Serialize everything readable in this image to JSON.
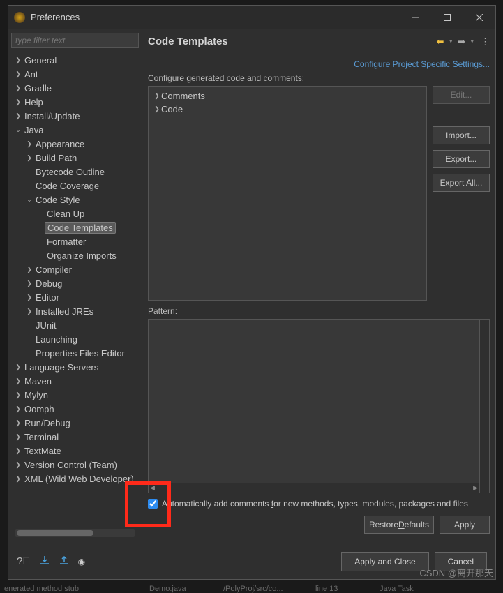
{
  "window": {
    "title": "Preferences"
  },
  "sidebar": {
    "filter_placeholder": "type filter text",
    "items": {
      "general": "General",
      "ant": "Ant",
      "gradle": "Gradle",
      "help": "Help",
      "install_update": "Install/Update",
      "java": "Java",
      "appearance": "Appearance",
      "build_path": "Build Path",
      "bytecode_outline": "Bytecode Outline",
      "code_coverage": "Code Coverage",
      "code_style": "Code Style",
      "clean_up": "Clean Up",
      "code_templates": "Code Templates",
      "formatter": "Formatter",
      "organize_imports": "Organize Imports",
      "compiler": "Compiler",
      "debug": "Debug",
      "editor": "Editor",
      "installed_jres": "Installed JREs",
      "junit": "JUnit",
      "launching": "Launching",
      "properties_files_editor": "Properties Files Editor",
      "language_servers": "Language Servers",
      "maven": "Maven",
      "mylyn": "Mylyn",
      "oomph": "Oomph",
      "run_debug": "Run/Debug",
      "terminal": "Terminal",
      "textmate": "TextMate",
      "version_control": "Version Control (Team)",
      "xml": "XML (Wild Web Developer)"
    }
  },
  "main": {
    "title": "Code Templates",
    "config_link": "Configure Project Specific Settings...",
    "desc": "Configure generated code and comments:",
    "tree": {
      "comments": "Comments",
      "code": "Code"
    },
    "buttons": {
      "edit": "Edit...",
      "import": "Import...",
      "export": "Export...",
      "export_all": "Export All..."
    },
    "pattern_label": "Pattern:",
    "auto_add_pre": "Automatically add comments ",
    "auto_add_f": "f",
    "auto_add_post": "or new methods, types, modules, packages and files",
    "restore_defaults": "Restore ",
    "restore_defaults_u": "D",
    "restore_defaults_post": "efaults",
    "apply": "Apply"
  },
  "footer": {
    "apply_close": "Apply and Close",
    "cancel": "Cancel"
  },
  "watermark": "CSDN @离开那天"
}
